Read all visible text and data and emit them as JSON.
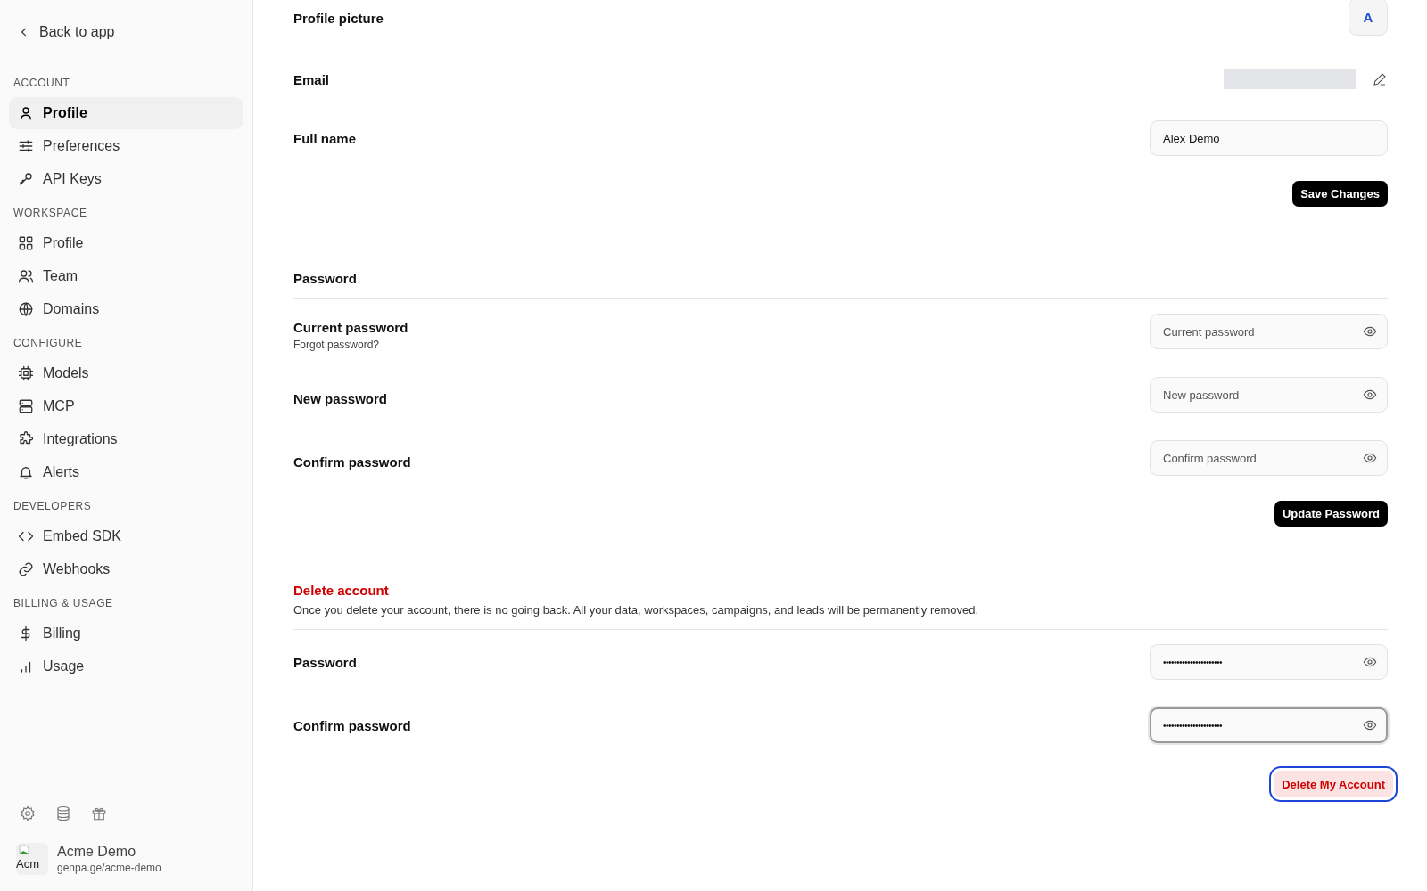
{
  "sidebar": {
    "back_link": "Back to app",
    "sections": [
      {
        "title": "ACCOUNT",
        "items": [
          {
            "label": "Profile",
            "selected": true
          },
          {
            "label": "Preferences",
            "selected": false
          },
          {
            "label": "API Keys",
            "selected": false
          }
        ]
      },
      {
        "title": "WORKSPACE",
        "items": [
          {
            "label": "Profile",
            "selected": false
          },
          {
            "label": "Team",
            "selected": false
          },
          {
            "label": "Domains",
            "selected": false
          }
        ]
      },
      {
        "title": "CONFIGURE",
        "items": [
          {
            "label": "Models",
            "selected": false
          },
          {
            "label": "MCP",
            "selected": false
          },
          {
            "label": "Integrations",
            "selected": false
          },
          {
            "label": "Alerts",
            "selected": false
          }
        ]
      },
      {
        "title": "DEVELOPERS",
        "items": [
          {
            "label": "Embed SDK",
            "selected": false
          },
          {
            "label": "Webhooks",
            "selected": false
          }
        ]
      },
      {
        "title": "BILLING & USAGE",
        "items": [
          {
            "label": "Billing",
            "selected": false
          },
          {
            "label": "Usage",
            "selected": false
          }
        ]
      }
    ],
    "account": {
      "avatar_alt": "Acm",
      "name": "Acme Demo",
      "url": "genpa.ge/acme-demo"
    }
  },
  "profile": {
    "picture": {
      "label": "Profile picture",
      "initial": "A"
    },
    "email": {
      "label": "Email"
    },
    "full_name": {
      "label": "Full name",
      "value": "Alex Demo"
    },
    "button": "Save Changes"
  },
  "password": {
    "title": "Password",
    "fields": [
      {
        "label": "Current password",
        "link": "Forgot password?",
        "placeholder": "Current password",
        "focused": false
      },
      {
        "label": "New password",
        "placeholder": "New password",
        "focused": false
      },
      {
        "label": "Confirm password",
        "placeholder": "Confirm password",
        "focused": false
      }
    ],
    "button": "Update Password"
  },
  "delete_account": {
    "title": "Delete account",
    "description": "Once you delete your account, there is no going back. All your data, workspaces, campaigns, and leads will be permanently removed.",
    "fields": [
      {
        "label": "Password",
        "value": "••••••••••••••••••••••",
        "focused": false
      },
      {
        "label": "Confirm password",
        "value": "••••••••••••••••••••••",
        "focused": true
      }
    ],
    "button": {
      "label": "Delete My Account",
      "focused": true
    }
  }
}
